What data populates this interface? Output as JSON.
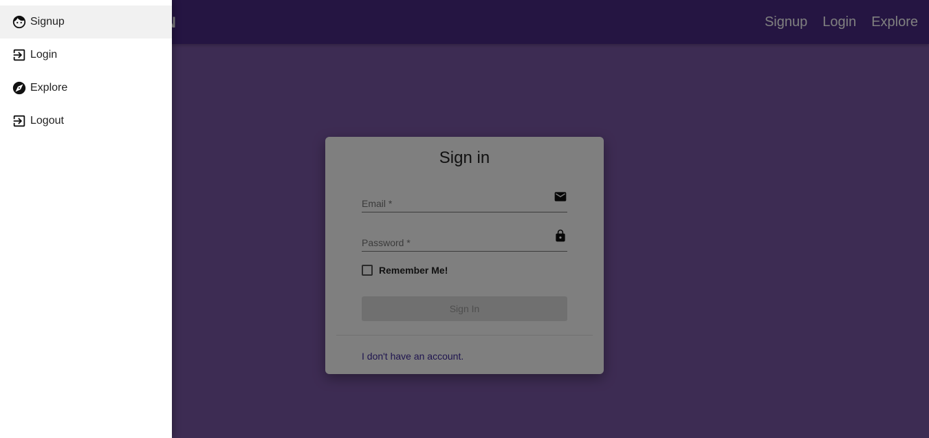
{
  "appbar": {
    "logo": "N",
    "nav": [
      "Signup",
      "Login",
      "Explore"
    ]
  },
  "card": {
    "title": "Sign in",
    "email_placeholder": "Email *",
    "password_placeholder": "Password *",
    "remember_label": "Remember Me!",
    "signin_label": "Sign In",
    "account_link": "I don't have an account."
  },
  "drawer": {
    "items": [
      {
        "label": "Signup",
        "icon": "face-icon"
      },
      {
        "label": "Login",
        "icon": "login-icon"
      },
      {
        "label": "Explore",
        "icon": "explore-icon"
      },
      {
        "label": "Logout",
        "icon": "logout-icon"
      }
    ]
  },
  "colors": {
    "appbar": "#4a2a84",
    "background": "#7b58a6",
    "link": "#3f2a9e"
  }
}
